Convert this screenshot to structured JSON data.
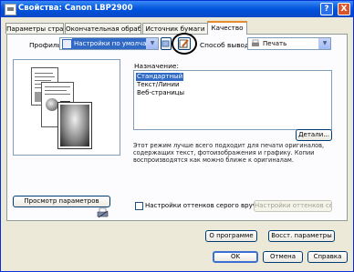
{
  "window": {
    "title": "Свойства: Canon LBP2900",
    "help_label": "?",
    "close_label": "X"
  },
  "tabs": [
    {
      "label": "Параметры страницы",
      "active": false
    },
    {
      "label": "Окончательная обработка",
      "active": false
    },
    {
      "label": "Источник бумаги",
      "active": false
    },
    {
      "label": "Качество",
      "active": true
    }
  ],
  "profile": {
    "label": "Профиль:",
    "value": "Настройки по умолчанию"
  },
  "output": {
    "label": "Способ вывода:",
    "value": "Печать"
  },
  "purpose": {
    "label": "Назначение:",
    "items": [
      {
        "label": "Стандартный",
        "selected": true
      },
      {
        "label": "Текст/Линии",
        "selected": false
      },
      {
        "label": "Веб-страницы",
        "selected": false
      }
    ],
    "details_label": "Детали...",
    "description": "Этот режим лучше всего подходит для печати оригиналов, содержащих текст, фотоизображения и графику. Копии воспроизводятся как можно ближе к оригиналам."
  },
  "view_settings_label": "Просмотр параметров",
  "grayscale": {
    "checkbox_label": "Настройки оттенков серого вручную",
    "settings_label": "Настройки оттенков серого...",
    "checked": false
  },
  "about_label": "О программе",
  "restore_label": "Восст. параметры",
  "ok_label": "OK",
  "cancel_label": "Отмена",
  "apply_label": "Справка"
}
